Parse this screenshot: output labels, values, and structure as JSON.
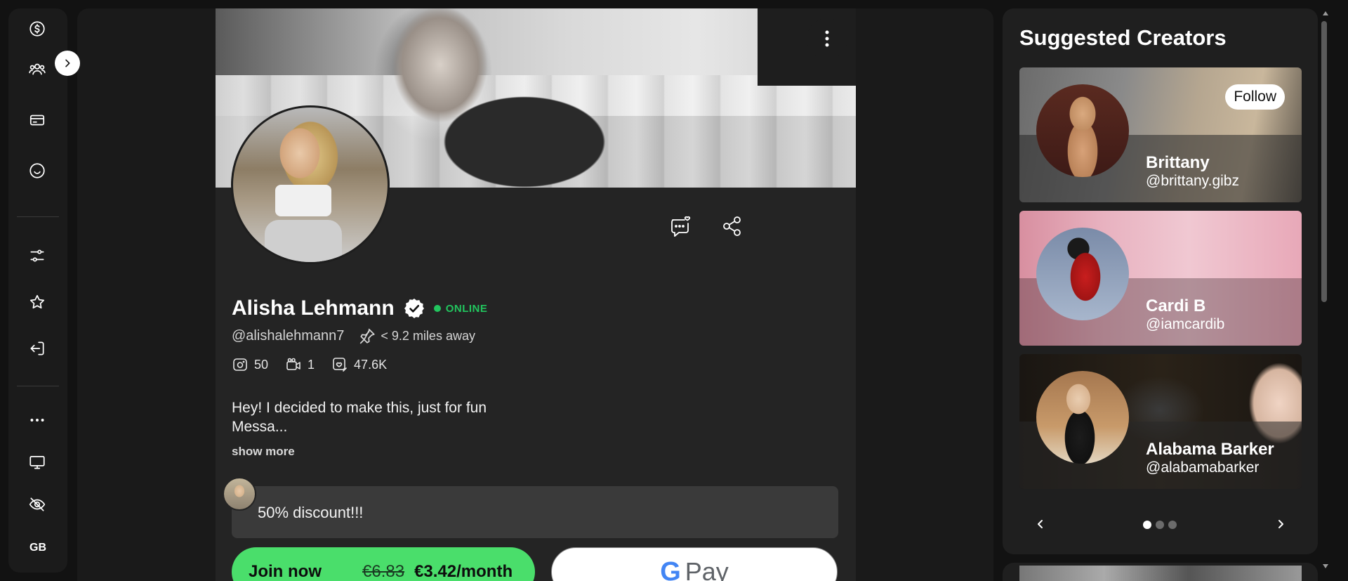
{
  "sidebar": {
    "items": [
      {
        "name": "dollar-icon"
      },
      {
        "name": "users-icon"
      },
      {
        "name": "card-icon"
      },
      {
        "name": "smile-icon"
      },
      {
        "name": "sliders-icon"
      },
      {
        "name": "star-icon"
      },
      {
        "name": "logout-icon"
      },
      {
        "name": "more-icon",
        "label": "..."
      },
      {
        "name": "monitor-icon"
      },
      {
        "name": "eye-off-icon"
      }
    ],
    "language": "GB"
  },
  "profile": {
    "name": "Alisha Lehmann",
    "status": "ONLINE",
    "handle": "@alishalehmann7",
    "distance": "< 9.2 miles away",
    "stats": {
      "photos": "50",
      "videos": "1",
      "likes": "47.6K"
    },
    "bio_line1": "Hey! I decided to make this, just for fun",
    "bio_line2": "Messa...",
    "show_more": "show more",
    "promo_text": "50% discount!!!",
    "join_label": "Join now",
    "old_price": "€6.83",
    "price": "€3.42/month",
    "gpay_g": "G",
    "gpay_pay": "Pay"
  },
  "suggested": {
    "title": "Suggested Creators",
    "follow_label": "Follow",
    "creators": [
      {
        "name": "Brittany",
        "handle": "@brittany.gibz"
      },
      {
        "name": "Cardi B",
        "handle": "@iamcardib"
      },
      {
        "name": "Alabama Barker",
        "handle": "@alabamabarker"
      }
    ],
    "page_count": 3,
    "active_page": 1
  },
  "colors": {
    "accent_green": "#4ade6b",
    "online_green": "#22c55e",
    "panel_bg": "#1f1f1f"
  }
}
